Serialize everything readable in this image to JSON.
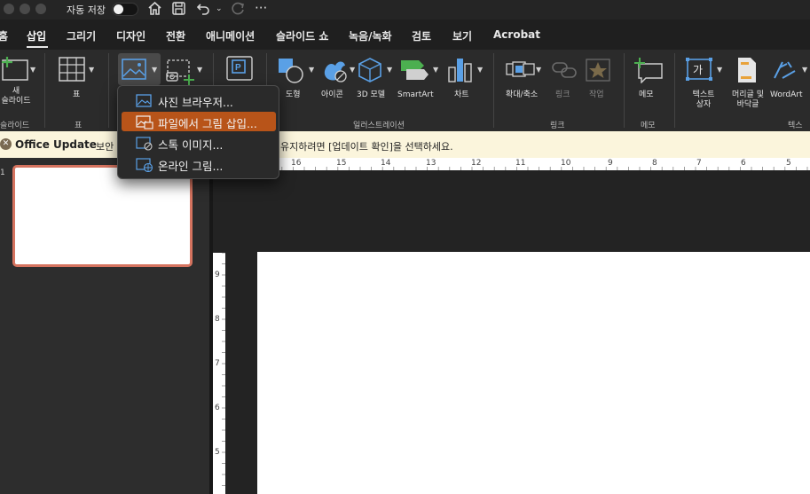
{
  "titlebar": {
    "autosave_label": "자동 저장",
    "autosave_on": false,
    "more_label": "···"
  },
  "tabs": [
    {
      "label": "홈"
    },
    {
      "label": "삽입",
      "active": true
    },
    {
      "label": "그리기"
    },
    {
      "label": "디자인"
    },
    {
      "label": "전환"
    },
    {
      "label": "애니메이션"
    },
    {
      "label": "슬라이드 쇼"
    },
    {
      "label": "녹음/녹화"
    },
    {
      "label": "검토"
    },
    {
      "label": "보기"
    },
    {
      "label": "Acrobat"
    }
  ],
  "ribbon": {
    "new_slide": "새\n슬라이드",
    "table": "표",
    "shapes": "도형",
    "icons": "아이콘",
    "models3d": "3D 모델",
    "smartart": "SmartArt",
    "chart": "차트",
    "zoom": "확대/축소",
    "link": "링크",
    "action": "작업",
    "comment": "메모",
    "textbox": "텍스트\n상자",
    "header_footer": "머리글 및\n바닥글",
    "wordart": "WordArt",
    "textbox_glyph": "가",
    "groups": {
      "slides": "슬라이드",
      "tables": "표",
      "illustrations": "일러스트레이션",
      "links": "링크",
      "comments": "메모",
      "text": "텍스"
    }
  },
  "menu": {
    "items": [
      {
        "label": "사진 브라우저...",
        "icon": "photo-icon"
      },
      {
        "label": "파일에서 그림 삽입...",
        "icon": "picture-from-file-icon",
        "highlighted": true
      },
      {
        "label": "스톡 이미지...",
        "icon": "stock-image-icon"
      },
      {
        "label": "온라인 그림...",
        "icon": "online-picture-icon"
      }
    ]
  },
  "notice": {
    "title": "Office Update",
    "message_start": "보안 업",
    "message_end": "유지하려면 [업데이트 확인]을 선택하세요."
  },
  "thumbnails": {
    "slide_number": "1"
  },
  "ruler": {
    "horizontal": [
      "16",
      "15",
      "14",
      "13",
      "12",
      "11",
      "10",
      "9",
      "8",
      "7",
      "6",
      "5"
    ],
    "vertical": [
      "9",
      "8",
      "7",
      "6",
      "5"
    ]
  },
  "colors": {
    "accent": "#b85419",
    "thumb_border": "#d5735f",
    "notice_bg": "#fbf5dc"
  }
}
